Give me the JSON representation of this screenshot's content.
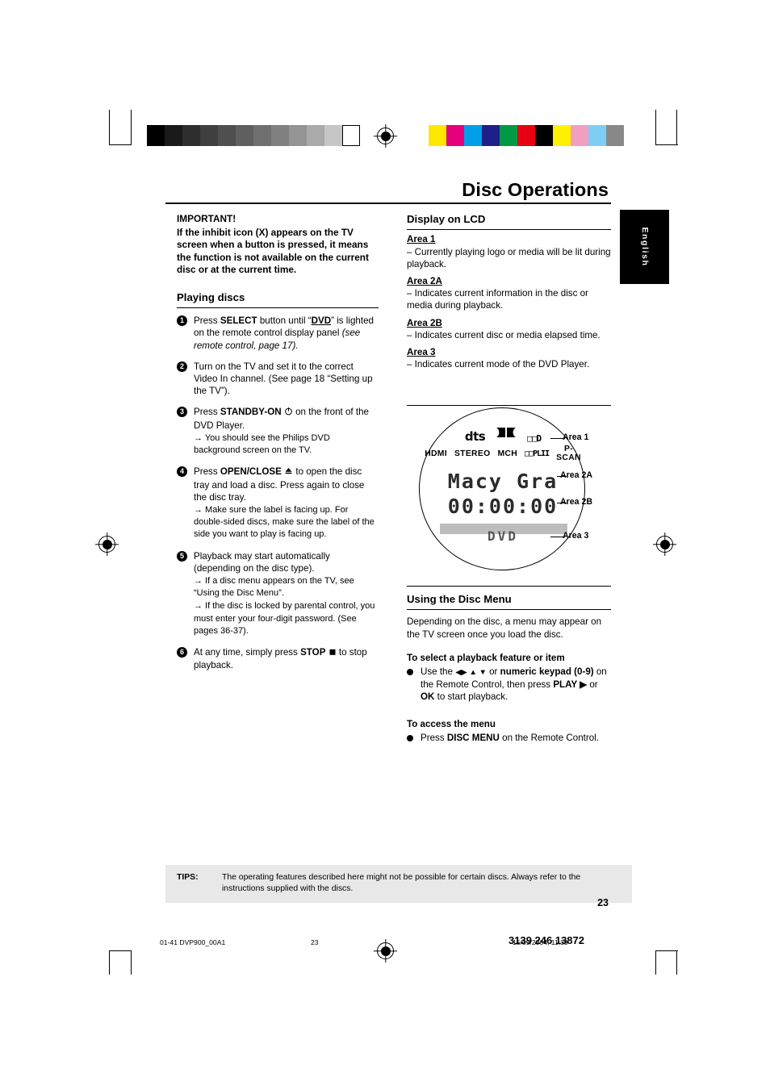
{
  "header": {
    "title": "Disc Operations",
    "language_tab": "English",
    "page_number": "23"
  },
  "left_column": {
    "important_heading": "IMPORTANT!",
    "important_text": "If the inhibit icon (X) appears on the TV screen when a button is pressed, it means the function is not available on the current disc or at the current time.",
    "playing_discs_heading": "Playing discs",
    "steps": [
      {
        "num": "1",
        "text_before": "Press ",
        "bold1": "SELECT",
        "text_mid": " button until “",
        "bold2": "DVD",
        "text_after": "” is lighted on the remote control display panel ",
        "italic": "(see remote control, page 17).",
        "subs": []
      },
      {
        "num": "2",
        "text": "Turn on the TV and set it to the correct Video In channel.  (See page 18 “Setting up the TV”).",
        "subs": []
      },
      {
        "num": "3",
        "text_before": "Press ",
        "bold1": "STANDBY-ON",
        "text_after": " on the front of the DVD Player.",
        "subs": [
          "→ You should see the Philips DVD background screen on the TV."
        ]
      },
      {
        "num": "4",
        "text_before": "Press ",
        "bold1": "OPEN/CLOSE",
        "text_after": " to open the disc tray and load a disc. Press again to close the disc tray.",
        "subs": [
          "→ Make sure the label is facing up.  For double-sided discs, make sure the label of the side you want to play is facing up."
        ]
      },
      {
        "num": "5",
        "text": "Playback may start automatically (depending on the disc type).",
        "subs": [
          "→ If a disc menu appears on the TV, see “Using the Disc Menu”.",
          "→ If the disc is locked by parental control, you must enter your four-digit password. (See pages 36-37)."
        ]
      },
      {
        "num": "6",
        "text_before": "At any time, simply press ",
        "bold1": "STOP",
        "text_after": " to stop playback.",
        "subs": []
      }
    ]
  },
  "right_column": {
    "display_heading": "Display on LCD",
    "areas": [
      {
        "label": "Area 1",
        "text": "–  Currently playing logo or media will be lit during playback."
      },
      {
        "label": "Area 2A",
        "text": "–  Indicates current information in the disc or media during playback."
      },
      {
        "label": "Area 2B",
        "text": "–  Indicates current disc or media elapsed time."
      },
      {
        "label": "Area 3",
        "text": "–  Indicates current mode of the DVD Player."
      }
    ],
    "lcd_figure": {
      "icons_row1": [
        "dts",
        "dd-logo",
        "dolby-digital-logo"
      ],
      "icons_row2": [
        "HDMI",
        "MCH",
        "P-SCAN"
      ],
      "dts_label": "dts",
      "hdmi_label": "HDMI",
      "stereo_label": "STEREO",
      "mch_label": "MCH",
      "dd_label": "□□D",
      "ddplii_label": "□□PLII",
      "pscan_label": "P-SCAN",
      "display_text": "Macy Gra",
      "display_time": "00:00:00",
      "display_mode": "DVD",
      "callouts": [
        "Area 1",
        "Area 2A",
        "Area 2B",
        "Area 3"
      ]
    },
    "disc_menu_heading": "Using the Disc Menu",
    "disc_menu_text": "Depending on the disc, a menu may appear on the TV screen once you load the disc.",
    "select_heading": "To select a playback feature or item",
    "select_text_1": "Use the ",
    "select_nav": "◀▶ ▲ ▼",
    "select_text_2": " or ",
    "select_bold_1": "numeric keypad (0-9)",
    "select_text_3": " on the Remote Control, then press ",
    "select_bold_2": "PLAY ▶",
    "select_text_4": " or ",
    "select_bold_3": "OK",
    "select_text_5": " to start playback.",
    "access_heading": "To access the menu",
    "access_text_1": "Press ",
    "access_bold": "DISC MENU",
    "access_text_2": " on the Remote Control."
  },
  "tips": {
    "label": "TIPS:",
    "text": "The operating features described here might not be possible for certain discs.  Always refer to the instructions supplied with the discs."
  },
  "footer": {
    "left": "01-41 DVP900_00A1",
    "center": "23",
    "right": "15/09/2004, 11:39",
    "part_number": "3139 246 13872"
  },
  "colors": {
    "bar_gray": "#bdbdbd",
    "tips_bg": "#e8e8e8",
    "segment": "#2b2b2b"
  }
}
